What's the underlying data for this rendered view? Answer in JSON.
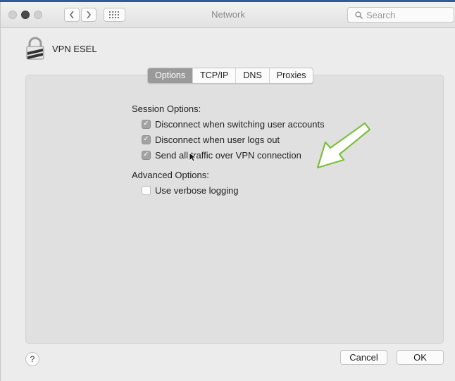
{
  "window": {
    "title": "Network"
  },
  "search": {
    "placeholder": "Search"
  },
  "vpn": {
    "name": "VPN ESEL"
  },
  "tabs": [
    {
      "label": "Options",
      "active": true
    },
    {
      "label": "TCP/IP",
      "active": false
    },
    {
      "label": "DNS",
      "active": false
    },
    {
      "label": "Proxies",
      "active": false
    }
  ],
  "session": {
    "title": "Session Options:",
    "options": [
      {
        "label": "Disconnect when switching user accounts",
        "checked": true
      },
      {
        "label": "Disconnect when user logs out",
        "checked": true
      },
      {
        "label": "Send all traffic over VPN connection",
        "checked": true
      }
    ]
  },
  "advanced": {
    "title": "Advanced Options:",
    "options": [
      {
        "label": "Use verbose logging",
        "checked": false
      }
    ]
  },
  "footer": {
    "help": "?",
    "cancel": "Cancel",
    "ok": "OK"
  },
  "colors": {
    "accent_arrow": "#7cbf3b",
    "tab_active": "#9a9a9a"
  }
}
